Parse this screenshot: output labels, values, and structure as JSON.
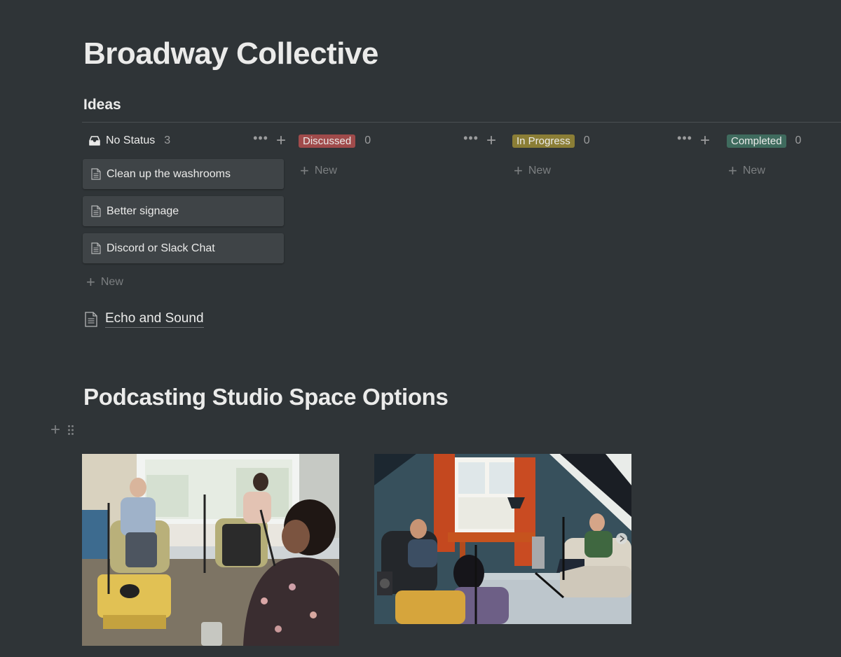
{
  "page": {
    "title": "Broadway Collective"
  },
  "database": {
    "title": "Ideas",
    "columns": [
      {
        "name": "No Status",
        "count": "3",
        "cards": [
          "Clean up the washrooms",
          "Better signage",
          "Discord or Slack Chat"
        ],
        "new_label": "New"
      },
      {
        "name": "Discussed",
        "count": "0",
        "color": "#a04b4b",
        "cards": [],
        "new_label": "New"
      },
      {
        "name": "In Progress",
        "count": "0",
        "color": "#8b7e36",
        "cards": [],
        "new_label": "New"
      },
      {
        "name": "Completed",
        "count": "0",
        "color": "#3f6b5e",
        "cards": [],
        "new_label": "New"
      }
    ]
  },
  "linked_page": {
    "label": "Echo and Sound"
  },
  "section": {
    "heading": "Podcasting Studio Space Options"
  },
  "icons": {
    "inbox": "inbox-icon",
    "document": "document-icon",
    "more": "more-horizontal-icon",
    "add": "plus-icon",
    "drag": "drag-handle-icon"
  }
}
